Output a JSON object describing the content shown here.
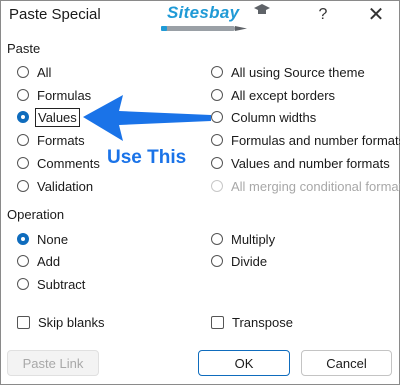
{
  "dialog": {
    "title": "Paste Special",
    "help_label": "?",
    "close_label": "✕"
  },
  "watermark": {
    "text": "Sitesbay"
  },
  "paste": {
    "section_label": "Paste",
    "left": [
      {
        "label": "All",
        "selected": false
      },
      {
        "label": "Formulas",
        "selected": false
      },
      {
        "label": "Values",
        "selected": true
      },
      {
        "label": "Formats",
        "selected": false
      },
      {
        "label": "Comments",
        "selected": false
      },
      {
        "label": "Validation",
        "selected": false
      }
    ],
    "right": [
      {
        "label": "All using Source theme",
        "selected": false
      },
      {
        "label": "All except borders",
        "selected": false
      },
      {
        "label": "Column widths",
        "selected": false
      },
      {
        "label": "Formulas and number formats",
        "selected": false
      },
      {
        "label": "Values and number formats",
        "selected": false
      },
      {
        "label": "All merging conditional formats",
        "selected": false,
        "disabled": true
      }
    ]
  },
  "operation": {
    "section_label": "Operation",
    "left": [
      {
        "label": "None",
        "selected": true
      },
      {
        "label": "Add",
        "selected": false
      },
      {
        "label": "Subtract",
        "selected": false
      }
    ],
    "right": [
      {
        "label": "Multiply",
        "selected": false
      },
      {
        "label": "Divide",
        "selected": false
      }
    ]
  },
  "checks": {
    "skip_blanks": {
      "label": "Skip blanks",
      "checked": false
    },
    "transpose": {
      "label": "Transpose",
      "checked": false
    }
  },
  "buttons": {
    "paste_link": "Paste Link",
    "ok": "OK",
    "cancel": "Cancel"
  },
  "annotation": {
    "text": "Use This"
  },
  "colors": {
    "accent": "#0f6cbd",
    "annotation": "#1a73e8",
    "watermark": "#1f9ad6"
  }
}
